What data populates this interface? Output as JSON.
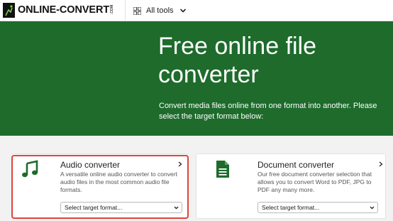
{
  "header": {
    "logo_text": "ONLINE-CONVERT",
    "logo_suffix": ".COM",
    "all_tools_label": "All tools"
  },
  "hero": {
    "title": "Free online file converter",
    "subtitle": "Convert media files online from one format into another. Please select the target format below:"
  },
  "cards": [
    {
      "title": "Audio converter",
      "description": "A versatile online audio converter to convert audio files in the most common audio file formats.",
      "select_value": "Select target format..."
    },
    {
      "title": "Document converter",
      "description": "Our free document converter selection that allows you to convert Word to PDF, JPG to PDF any many more.",
      "select_value": "Select target format..."
    }
  ],
  "colors": {
    "brand_green": "#1e6b2c",
    "highlight": "#e0443a"
  }
}
